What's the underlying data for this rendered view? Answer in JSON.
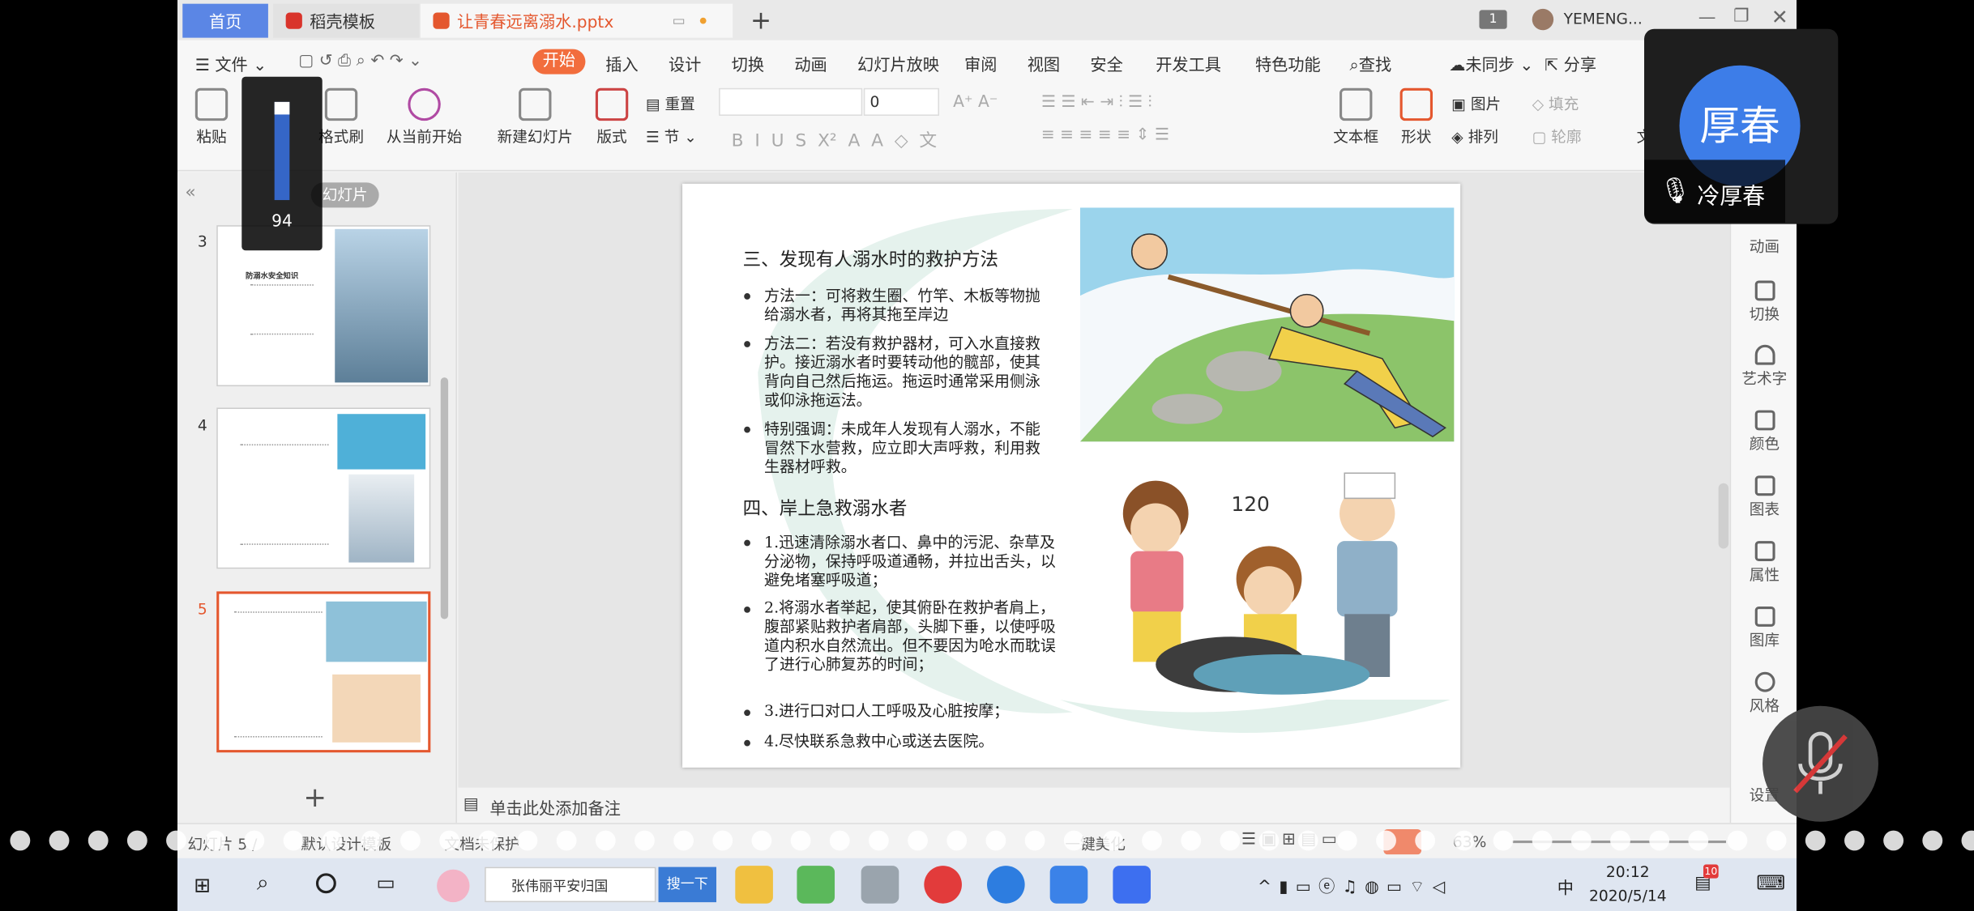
{
  "tabs": {
    "home": "首页",
    "daoke": "稻壳模板",
    "doc": "让青春远离溺水.pptx",
    "badge": "1",
    "user": "YEMENG..."
  },
  "menu": {
    "file": "文件",
    "items": [
      "开始",
      "插入",
      "设计",
      "切换",
      "动画",
      "幻灯片放映",
      "审阅",
      "视图",
      "安全",
      "开发工具",
      "特色功能"
    ],
    "search": "查找",
    "sync": "未同步",
    "share": "分享"
  },
  "ribbon": {
    "paste": "粘贴",
    "format_painter": "格式刷",
    "play_from_current": "从当前开始",
    "new_slide": "新建幻灯片",
    "layout": "版式",
    "reset": "重置",
    "section": "节",
    "font_size": "0",
    "textbox": "文本框",
    "shape": "形状",
    "picture": "图片",
    "arrange": "排列",
    "fill": "填充",
    "outline": "轮廓",
    "doc_partial": "文档"
  },
  "left_panel": {
    "label": "幻灯片",
    "thumb_numbers": [
      "3",
      "4",
      "5"
    ],
    "thumb3_title": "防溺水安全知识",
    "add": "+"
  },
  "volume": {
    "value": "94"
  },
  "slide": {
    "heading3": "三、发现有人溺水时的救护方法",
    "b1": "方法一：可将救生圈、竹竿、木板等物抛给溺水者，再将其拖至岸边",
    "b2": "方法二：若没有救护器材，可入水直接救护。接近溺水者时要转动他的髋部，使其背向自己然后拖运。拖运时通常采用侧泳或仰泳拖运法。",
    "b3": "特别强调：未成年人发现有人溺水，不能冒然下水营救，应立即大声呼救，利用救生器材呼救。",
    "heading4": "四、岸上急救溺水者",
    "c1": "1.迅速清除溺水者口、鼻中的污泥、杂草及分泌物，保持呼吸道通畅，并拉出舌头，以避免堵塞呼吸道；",
    "c2": "2.将溺水者举起，使其俯卧在救护者肩上，腹部紧贴救护者肩部，头脚下垂，以使呼吸道内积水自然流出。但不要因为呛水而耽误了进行心肺复苏的时间；",
    "c3": "3.进行口对口人工呼吸及心脏按摩；",
    "c4": "4.尽快联系急救中心或送去医院。",
    "img2_text": "120"
  },
  "notes": "单击此处添加备注",
  "right_bar": [
    "动画",
    "切换",
    "艺术字",
    "颜色",
    "图表",
    "属性",
    "图库",
    "风格",
    "设置"
  ],
  "status": {
    "slide_no": "幻灯片 5 /",
    "theme": "默认设计模板",
    "protect": "文档未保护",
    "beautify": "一键美化",
    "zoom": "63%"
  },
  "taskbar": {
    "search_text": "张伟丽平安归国",
    "search_btn": "搜一下",
    "time": "20:12",
    "date": "2020/5/14",
    "notif": "10",
    "ime": "中"
  },
  "call": {
    "avatar_text": "厚春",
    "speaker": "冷厚春"
  },
  "colors": {
    "accent": "#f26d3d",
    "home_tab": "#5b86e5",
    "avatar": "#3d7de8"
  }
}
